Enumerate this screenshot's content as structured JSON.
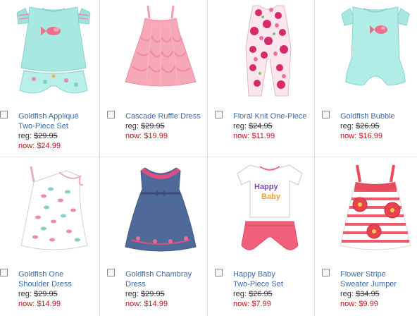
{
  "products": [
    {
      "name_line1": "Goldfish Appliqué",
      "name_line2": "Two-Piece Set",
      "reg_label": "reg:",
      "reg_price": "$29.95",
      "now_label": "now:",
      "now_price": "$24.99",
      "image": "aqua-top-and-bloomers"
    },
    {
      "name_line1": "Cascade Ruffle Dress",
      "name_line2": "",
      "reg_label": "reg:",
      "reg_price": "$29.95",
      "now_label": "now:",
      "now_price": "$19.99",
      "image": "pink-ruffle-dress"
    },
    {
      "name_line1": "Floral Knit One-Piece",
      "name_line2": "",
      "reg_label": "reg:",
      "reg_price": "$24.95",
      "now_label": "now:",
      "now_price": "$11.99",
      "image": "floral-romper"
    },
    {
      "name_line1": "Goldfish Bubble",
      "name_line2": "",
      "reg_label": "reg:",
      "reg_price": "$26.95",
      "now_label": "now:",
      "now_price": "$16.99",
      "image": "aqua-bubble-romper"
    },
    {
      "name_line1": "Goldfish One",
      "name_line2": "Shoulder Dress",
      "reg_label": "reg:",
      "reg_price": "$29.95",
      "now_label": "now:",
      "now_price": "$14.99",
      "image": "white-one-shoulder-dress"
    },
    {
      "name_line1": "Goldfish Chambray",
      "name_line2": "Dress",
      "reg_label": "reg:",
      "reg_price": "$29.95",
      "now_label": "now:",
      "now_price": "$14.99",
      "image": "chambray-dress"
    },
    {
      "name_line1": "Happy Baby",
      "name_line2": "Two-Piece Set",
      "reg_label": "reg:",
      "reg_price": "$26.95",
      "now_label": "now:",
      "now_price": "$7.99",
      "image": "happy-baby-tee-and-shorts",
      "tee_text_1": "Happy",
      "tee_text_2": "Baby"
    },
    {
      "name_line1": "Flower Stripe",
      "name_line2": "Sweater Jumper",
      "reg_label": "reg:",
      "reg_price": "$34.95",
      "now_label": "now:",
      "now_price": "$9.99",
      "image": "striped-flower-jumper"
    }
  ],
  "colors": {
    "link": "#3c6aa8",
    "sale": "#c0141a",
    "divider": "#dcdcdc"
  }
}
